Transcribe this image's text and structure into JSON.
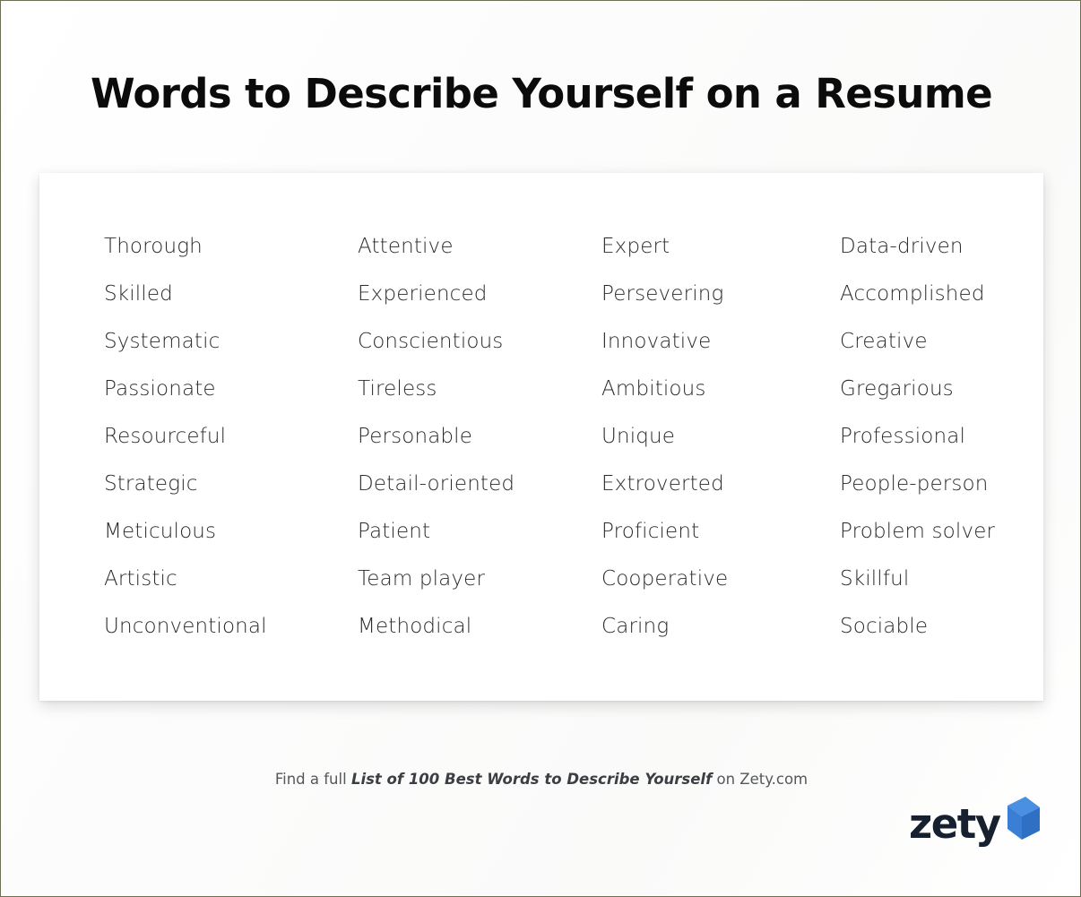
{
  "page": {
    "title": "Words to Describe Yourself on a Resume",
    "border_color": "#6e6e55",
    "background_color": "#fdfdfd",
    "card_background": "#ffffff",
    "word_color": "#2b2b2b"
  },
  "columns": [
    {
      "id": "column-1",
      "words": [
        "Thorough",
        "Skilled",
        "Systematic",
        "Passionate",
        "Resourceful",
        "Strategic",
        "Meticulous",
        "Artistic",
        "Unconventional"
      ]
    },
    {
      "id": "column-2",
      "words": [
        "Attentive",
        "Experienced",
        "Conscientious",
        "Tireless",
        "Personable",
        "Detail-oriented",
        "Patient",
        "Team player",
        "Methodical"
      ]
    },
    {
      "id": "column-3",
      "words": [
        "Expert",
        "Persevering",
        "Innovative",
        "Ambitious",
        "Unique",
        "Extroverted",
        "Proficient",
        "Cooperative",
        "Caring"
      ]
    },
    {
      "id": "column-4",
      "words": [
        "Data-driven",
        "Accomplished",
        "Creative",
        "Gregarious",
        "Professional",
        "People-person",
        "Problem solver",
        "Skillful",
        "Sociable"
      ]
    }
  ],
  "footer": {
    "prefix": "Find a full ",
    "emphasis": "List of 100 Best Words to Describe Yourself",
    "suffix": " on Zety.com"
  },
  "logo": {
    "wordmark": "zety",
    "icon_name": "zety-chevron-icon",
    "wordmark_color": "#16202e",
    "mark_color_light": "#4a90e2",
    "mark_color_mid": "#3a7fd5",
    "mark_color_dark": "#2f6fc4"
  }
}
